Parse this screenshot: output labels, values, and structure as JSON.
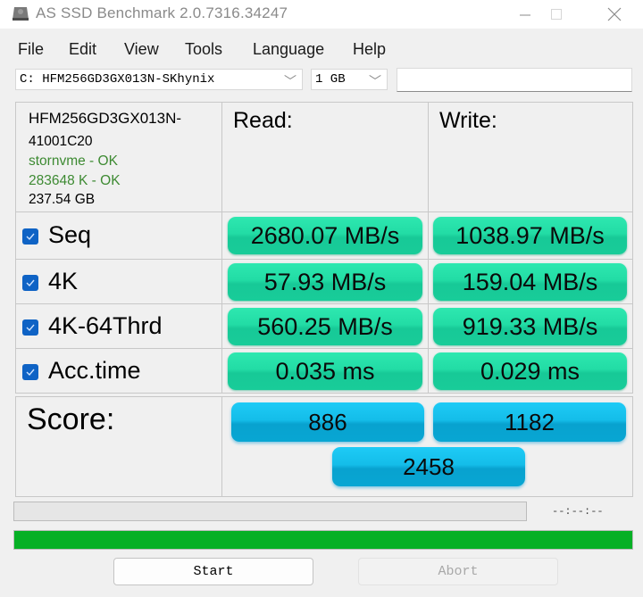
{
  "window": {
    "title": "AS SSD Benchmark 2.0.7316.34247",
    "icon": "drive-icon",
    "controls": {
      "minimize": "—",
      "maximize": "☐",
      "close": "✕"
    }
  },
  "menu": [
    "File",
    "Edit",
    "View",
    "Tools",
    "Language",
    "Help"
  ],
  "toolbar": {
    "drive_select": "C: HFM256GD3GX013N-SKhynix",
    "size_select": "1 GB",
    "text_field": "",
    "chevron": "﹀"
  },
  "drive_info": {
    "model": "HFM256GD3GX013N-",
    "firmware": "41001C20",
    "driver_status": "stornvme - OK",
    "alignment_status": "283648 K - OK",
    "capacity": "237.54 GB"
  },
  "headers": {
    "read": "Read:",
    "write": "Write:",
    "score": "Score:"
  },
  "tests": [
    {
      "label": "Seq",
      "checked": true,
      "read": "2680.07 MB/s",
      "write": "1038.97 MB/s"
    },
    {
      "label": "4K",
      "checked": true,
      "read": "57.93 MB/s",
      "write": "159.04 MB/s"
    },
    {
      "label": "4K-64Thrd",
      "checked": true,
      "read": "560.25 MB/s",
      "write": "919.33 MB/s"
    },
    {
      "label": "Acc.time",
      "checked": true,
      "read": "0.035 ms",
      "write": "0.029 ms"
    }
  ],
  "score": {
    "read": "886",
    "write": "1182",
    "total": "2458"
  },
  "progress": {
    "elapsed": "--:--:--",
    "test_progress_fraction": 0,
    "overall_progress_fraction": 1.0
  },
  "buttons": {
    "start": "Start",
    "abort": "Abort"
  },
  "colors": {
    "result_green": "#22dca5",
    "score_blue": "#14bde9",
    "progress_green": "#06b025",
    "checkbox_blue": "#0f63c5",
    "status_green": "#3d8a32"
  }
}
